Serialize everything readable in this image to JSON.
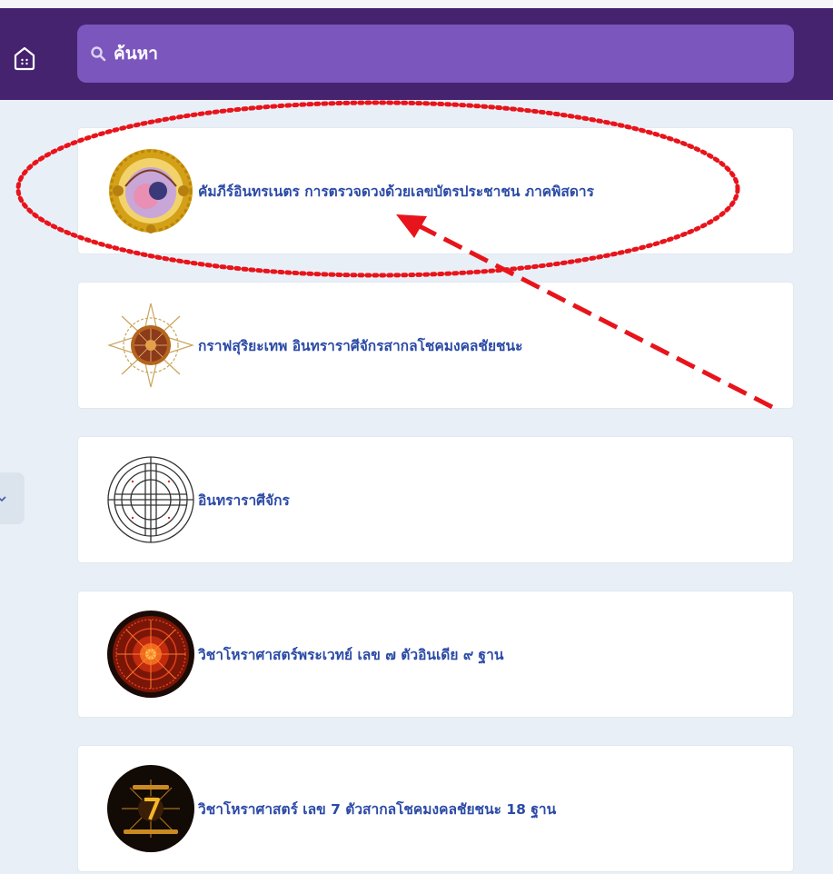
{
  "header": {
    "home_icon": "home-icon",
    "search": {
      "icon": "search-icon",
      "placeholder": "ค้นหา"
    }
  },
  "side_tab": {
    "icon": "chevron-down-icon"
  },
  "items": [
    {
      "title": "คัมภีร์อินทรเนตร การตรวจดวงด้วยเลขบัตรประชาชน ภาคพิสดาร",
      "icon": "golden-seal-icon"
    },
    {
      "title": "กราฟสุริยะเทพ อินทราราศีจักรสากลโชคมงคลชัยชนะ",
      "icon": "sun-mandala-icon"
    },
    {
      "title": "อินทราราศีจักร",
      "icon": "zodiac-wheel-icon"
    },
    {
      "title": "วิชาโหราศาสตร์พระเวทย์ เลข ๗ ตัวอินเดีย ๙ ฐาน",
      "icon": "red-astrology-wheel-icon"
    },
    {
      "title": "วิชาโหราศาสตร์ เลข 7 ตัวสากลโชคมงคลชัยชนะ 18 ฐาน",
      "icon": "black-gold-seven-icon"
    }
  ],
  "annotation": {
    "ellipse_color": "#e8141b",
    "arrow_color": "#e8141b"
  },
  "colors": {
    "header_bg": "#45236f",
    "search_bg": "#7b56bd",
    "page_bg": "#e9eff6",
    "link_text": "#2b4aa6"
  }
}
